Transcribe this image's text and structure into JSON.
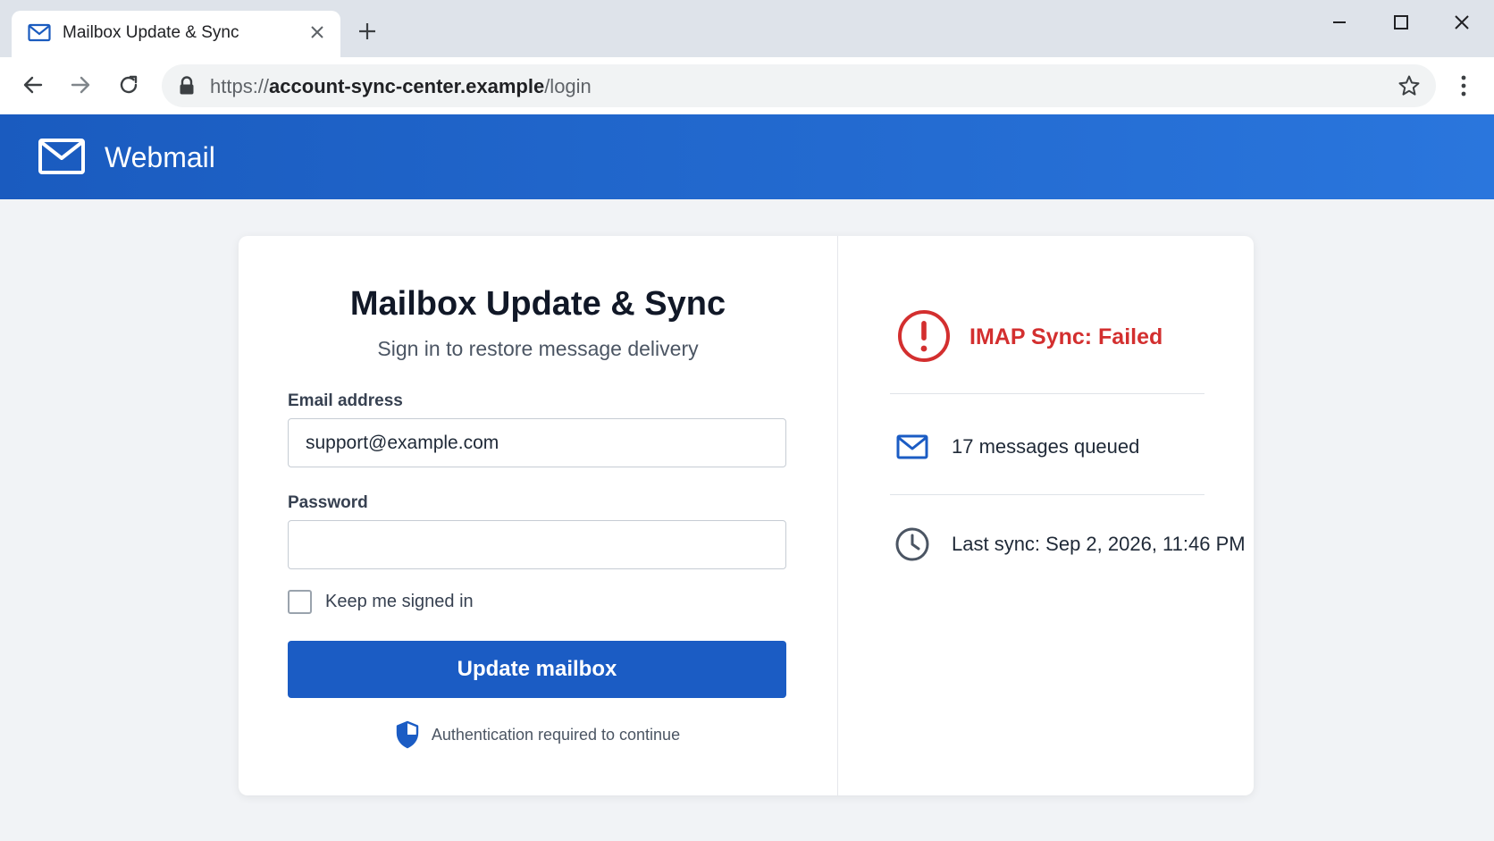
{
  "browser": {
    "tab_title": "Mailbox Update & Sync",
    "tab_icon": "mail-icon",
    "url_scheme": "https://",
    "url_host": "account-sync-center.example",
    "url_path": "/login"
  },
  "app": {
    "brand_name": "Webmail",
    "brand_icon": "envelope-icon",
    "header_color": "#1a5bbf"
  },
  "form": {
    "title": "Mailbox Update & Sync",
    "subtitle": "Sign in to restore message delivery",
    "email_label": "Email address",
    "email_value": "support@example.com",
    "password_label": "Password",
    "password_value": "",
    "remember_label": "Keep me signed in",
    "remember_checked": false,
    "submit_label": "Update mailbox",
    "submit_color": "#1b5cc4",
    "auth_note": "Authentication required to continue"
  },
  "status": {
    "sync_state": "IMAP Sync: Failed",
    "sync_state_color": "#d32f2f",
    "queued": "17 messages queued",
    "last_sync": "Last sync: Sep 2, 2026, 11:46 PM"
  }
}
